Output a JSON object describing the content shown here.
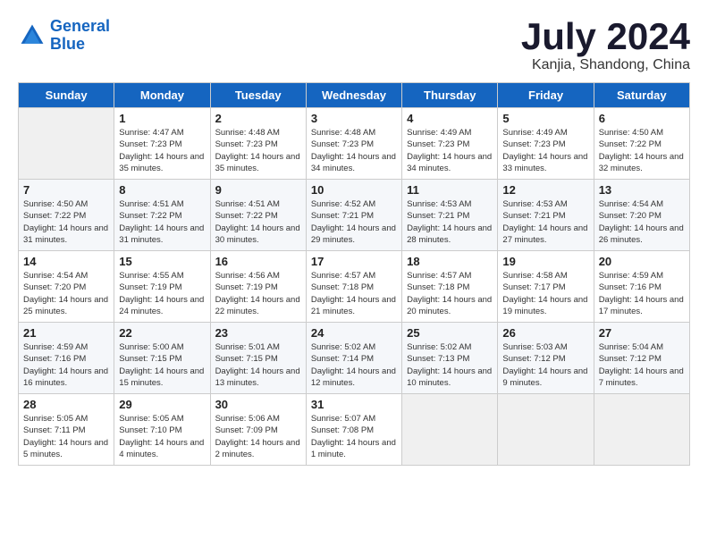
{
  "header": {
    "logo_line1": "General",
    "logo_line2": "Blue",
    "month": "July 2024",
    "location": "Kanjia, Shandong, China"
  },
  "days_of_week": [
    "Sunday",
    "Monday",
    "Tuesday",
    "Wednesday",
    "Thursday",
    "Friday",
    "Saturday"
  ],
  "weeks": [
    [
      {
        "day": "",
        "sunrise": "",
        "sunset": "",
        "daylight": ""
      },
      {
        "day": "1",
        "sunrise": "Sunrise: 4:47 AM",
        "sunset": "Sunset: 7:23 PM",
        "daylight": "Daylight: 14 hours and 35 minutes."
      },
      {
        "day": "2",
        "sunrise": "Sunrise: 4:48 AM",
        "sunset": "Sunset: 7:23 PM",
        "daylight": "Daylight: 14 hours and 35 minutes."
      },
      {
        "day": "3",
        "sunrise": "Sunrise: 4:48 AM",
        "sunset": "Sunset: 7:23 PM",
        "daylight": "Daylight: 14 hours and 34 minutes."
      },
      {
        "day": "4",
        "sunrise": "Sunrise: 4:49 AM",
        "sunset": "Sunset: 7:23 PM",
        "daylight": "Daylight: 14 hours and 34 minutes."
      },
      {
        "day": "5",
        "sunrise": "Sunrise: 4:49 AM",
        "sunset": "Sunset: 7:23 PM",
        "daylight": "Daylight: 14 hours and 33 minutes."
      },
      {
        "day": "6",
        "sunrise": "Sunrise: 4:50 AM",
        "sunset": "Sunset: 7:22 PM",
        "daylight": "Daylight: 14 hours and 32 minutes."
      }
    ],
    [
      {
        "day": "7",
        "sunrise": "Sunrise: 4:50 AM",
        "sunset": "Sunset: 7:22 PM",
        "daylight": "Daylight: 14 hours and 31 minutes."
      },
      {
        "day": "8",
        "sunrise": "Sunrise: 4:51 AM",
        "sunset": "Sunset: 7:22 PM",
        "daylight": "Daylight: 14 hours and 31 minutes."
      },
      {
        "day": "9",
        "sunrise": "Sunrise: 4:51 AM",
        "sunset": "Sunset: 7:22 PM",
        "daylight": "Daylight: 14 hours and 30 minutes."
      },
      {
        "day": "10",
        "sunrise": "Sunrise: 4:52 AM",
        "sunset": "Sunset: 7:21 PM",
        "daylight": "Daylight: 14 hours and 29 minutes."
      },
      {
        "day": "11",
        "sunrise": "Sunrise: 4:53 AM",
        "sunset": "Sunset: 7:21 PM",
        "daylight": "Daylight: 14 hours and 28 minutes."
      },
      {
        "day": "12",
        "sunrise": "Sunrise: 4:53 AM",
        "sunset": "Sunset: 7:21 PM",
        "daylight": "Daylight: 14 hours and 27 minutes."
      },
      {
        "day": "13",
        "sunrise": "Sunrise: 4:54 AM",
        "sunset": "Sunset: 7:20 PM",
        "daylight": "Daylight: 14 hours and 26 minutes."
      }
    ],
    [
      {
        "day": "14",
        "sunrise": "Sunrise: 4:54 AM",
        "sunset": "Sunset: 7:20 PM",
        "daylight": "Daylight: 14 hours and 25 minutes."
      },
      {
        "day": "15",
        "sunrise": "Sunrise: 4:55 AM",
        "sunset": "Sunset: 7:19 PM",
        "daylight": "Daylight: 14 hours and 24 minutes."
      },
      {
        "day": "16",
        "sunrise": "Sunrise: 4:56 AM",
        "sunset": "Sunset: 7:19 PM",
        "daylight": "Daylight: 14 hours and 22 minutes."
      },
      {
        "day": "17",
        "sunrise": "Sunrise: 4:57 AM",
        "sunset": "Sunset: 7:18 PM",
        "daylight": "Daylight: 14 hours and 21 minutes."
      },
      {
        "day": "18",
        "sunrise": "Sunrise: 4:57 AM",
        "sunset": "Sunset: 7:18 PM",
        "daylight": "Daylight: 14 hours and 20 minutes."
      },
      {
        "day": "19",
        "sunrise": "Sunrise: 4:58 AM",
        "sunset": "Sunset: 7:17 PM",
        "daylight": "Daylight: 14 hours and 19 minutes."
      },
      {
        "day": "20",
        "sunrise": "Sunrise: 4:59 AM",
        "sunset": "Sunset: 7:16 PM",
        "daylight": "Daylight: 14 hours and 17 minutes."
      }
    ],
    [
      {
        "day": "21",
        "sunrise": "Sunrise: 4:59 AM",
        "sunset": "Sunset: 7:16 PM",
        "daylight": "Daylight: 14 hours and 16 minutes."
      },
      {
        "day": "22",
        "sunrise": "Sunrise: 5:00 AM",
        "sunset": "Sunset: 7:15 PM",
        "daylight": "Daylight: 14 hours and 15 minutes."
      },
      {
        "day": "23",
        "sunrise": "Sunrise: 5:01 AM",
        "sunset": "Sunset: 7:15 PM",
        "daylight": "Daylight: 14 hours and 13 minutes."
      },
      {
        "day": "24",
        "sunrise": "Sunrise: 5:02 AM",
        "sunset": "Sunset: 7:14 PM",
        "daylight": "Daylight: 14 hours and 12 minutes."
      },
      {
        "day": "25",
        "sunrise": "Sunrise: 5:02 AM",
        "sunset": "Sunset: 7:13 PM",
        "daylight": "Daylight: 14 hours and 10 minutes."
      },
      {
        "day": "26",
        "sunrise": "Sunrise: 5:03 AM",
        "sunset": "Sunset: 7:12 PM",
        "daylight": "Daylight: 14 hours and 9 minutes."
      },
      {
        "day": "27",
        "sunrise": "Sunrise: 5:04 AM",
        "sunset": "Sunset: 7:12 PM",
        "daylight": "Daylight: 14 hours and 7 minutes."
      }
    ],
    [
      {
        "day": "28",
        "sunrise": "Sunrise: 5:05 AM",
        "sunset": "Sunset: 7:11 PM",
        "daylight": "Daylight: 14 hours and 5 minutes."
      },
      {
        "day": "29",
        "sunrise": "Sunrise: 5:05 AM",
        "sunset": "Sunset: 7:10 PM",
        "daylight": "Daylight: 14 hours and 4 minutes."
      },
      {
        "day": "30",
        "sunrise": "Sunrise: 5:06 AM",
        "sunset": "Sunset: 7:09 PM",
        "daylight": "Daylight: 14 hours and 2 minutes."
      },
      {
        "day": "31",
        "sunrise": "Sunrise: 5:07 AM",
        "sunset": "Sunset: 7:08 PM",
        "daylight": "Daylight: 14 hours and 1 minute."
      },
      {
        "day": "",
        "sunrise": "",
        "sunset": "",
        "daylight": ""
      },
      {
        "day": "",
        "sunrise": "",
        "sunset": "",
        "daylight": ""
      },
      {
        "day": "",
        "sunrise": "",
        "sunset": "",
        "daylight": ""
      }
    ]
  ]
}
